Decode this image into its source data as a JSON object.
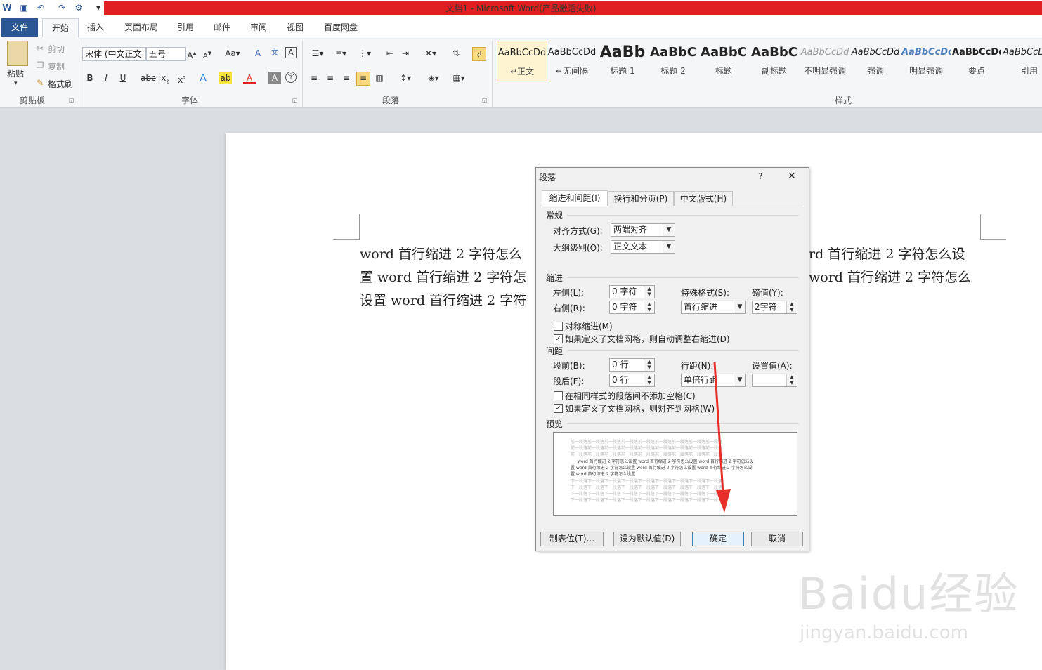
{
  "app": {
    "title": "文档1 - Microsoft Word(产品激活失败)"
  },
  "ribbon": {
    "tabs": [
      "文件",
      "开始",
      "插入",
      "页面布局",
      "引用",
      "邮件",
      "审阅",
      "视图",
      "百度网盘"
    ],
    "clipboard": {
      "paste": "粘贴",
      "cut": "剪切",
      "copy": "复制",
      "format_painter": "格式刷",
      "group": "剪贴板"
    },
    "font": {
      "name": "宋体 (中文正文",
      "size": "五号",
      "group": "字体"
    },
    "paragraph": {
      "group": "段落"
    },
    "styles": {
      "group": "样式",
      "items": [
        {
          "sample": "AaBbCcDd",
          "name": "↵正文"
        },
        {
          "sample": "AaBbCcDd",
          "name": "↵无间隔"
        },
        {
          "sample": "AaBb",
          "name": "标题 1"
        },
        {
          "sample": "AaBbC",
          "name": "标题 2"
        },
        {
          "sample": "AaBbC",
          "name": "标题"
        },
        {
          "sample": "AaBbC",
          "name": "副标题"
        },
        {
          "sample": "AaBbCcDd",
          "name": "不明显强调"
        },
        {
          "sample": "AaBbCcDd",
          "name": "强调"
        },
        {
          "sample": "AaBbCcDd",
          "name": "明显强调"
        },
        {
          "sample": "AaBbCcDd",
          "name": "要点"
        },
        {
          "sample": "AaBbCcDd",
          "name": "引用"
        }
      ]
    }
  },
  "document": {
    "lines_left": [
      "word 首行缩进 2 字符怎么",
      "置 word 首行缩进 2 字符怎",
      "设置 word 首行缩进 2 字符"
    ],
    "lines_right": [
      "rd 首行缩进 2 字符怎么设",
      "word 首行缩进 2 字符怎么",
      ""
    ]
  },
  "dialog": {
    "title": "段落",
    "help": "?",
    "close": "✕",
    "tabs": [
      "缩进和间距(I)",
      "换行和分页(P)",
      "中文版式(H)"
    ],
    "general": {
      "section": "常规",
      "alignment_label": "对齐方式(G):",
      "alignment_value": "两端对齐",
      "outline_label": "大纲级别(O):",
      "outline_value": "正文文本"
    },
    "indent": {
      "section": "缩进",
      "left_label": "左侧(L):",
      "left_value": "0 字符",
      "right_label": "右侧(R):",
      "right_value": "0 字符",
      "special_label": "特殊格式(S):",
      "special_value": "首行缩进",
      "by_label": "磅值(Y):",
      "by_value": "2字符",
      "mirror_label": "对称缩进(M)",
      "auto_adjust_label": "如果定义了文档网格，则自动调整右缩进(D)"
    },
    "spacing": {
      "section": "间距",
      "before_label": "段前(B):",
      "before_value": "0 行",
      "after_label": "段后(F):",
      "after_value": "0 行",
      "line_label": "行距(N):",
      "line_value": "单倍行距",
      "at_label": "设置值(A):",
      "at_value": "",
      "no_space_label": "在相同样式的段落间不添加空格(C)",
      "snap_grid_label": "如果定义了文档网格，则对齐到网格(W)"
    },
    "preview": {
      "section": "预览",
      "prev_text": "前一段落前一段落前一段落前一段落前一段落前一段落前一段落前一段落前一段落",
      "sample_lines": [
        "word 首行缩进 2 字符怎么设置 word 首行缩进 2 字符怎么设置 word 首行缩进 2 字符怎么设",
        "置 word 首行缩进 2 字符怎么设置 word 首行缩进 2 字符怎么设置 word 首行缩进 2 字符怎么设",
        "置 word 首行缩进 2 字符怎么设置"
      ],
      "next_text": "下一段落下一段落下一段落下一段落下一段落下一段落下一段落下一段落下一段落"
    },
    "buttons": {
      "tabs": "制表位(T)...",
      "set_default": "设为默认值(D)",
      "ok": "确定",
      "cancel": "取消"
    }
  },
  "watermark": {
    "main": "Baidu经验",
    "sub": "jingyan.baidu.com"
  },
  "colors": {
    "title_red": "#e02020",
    "file_tab": "#2b5797",
    "arrow": "#e8302a"
  }
}
